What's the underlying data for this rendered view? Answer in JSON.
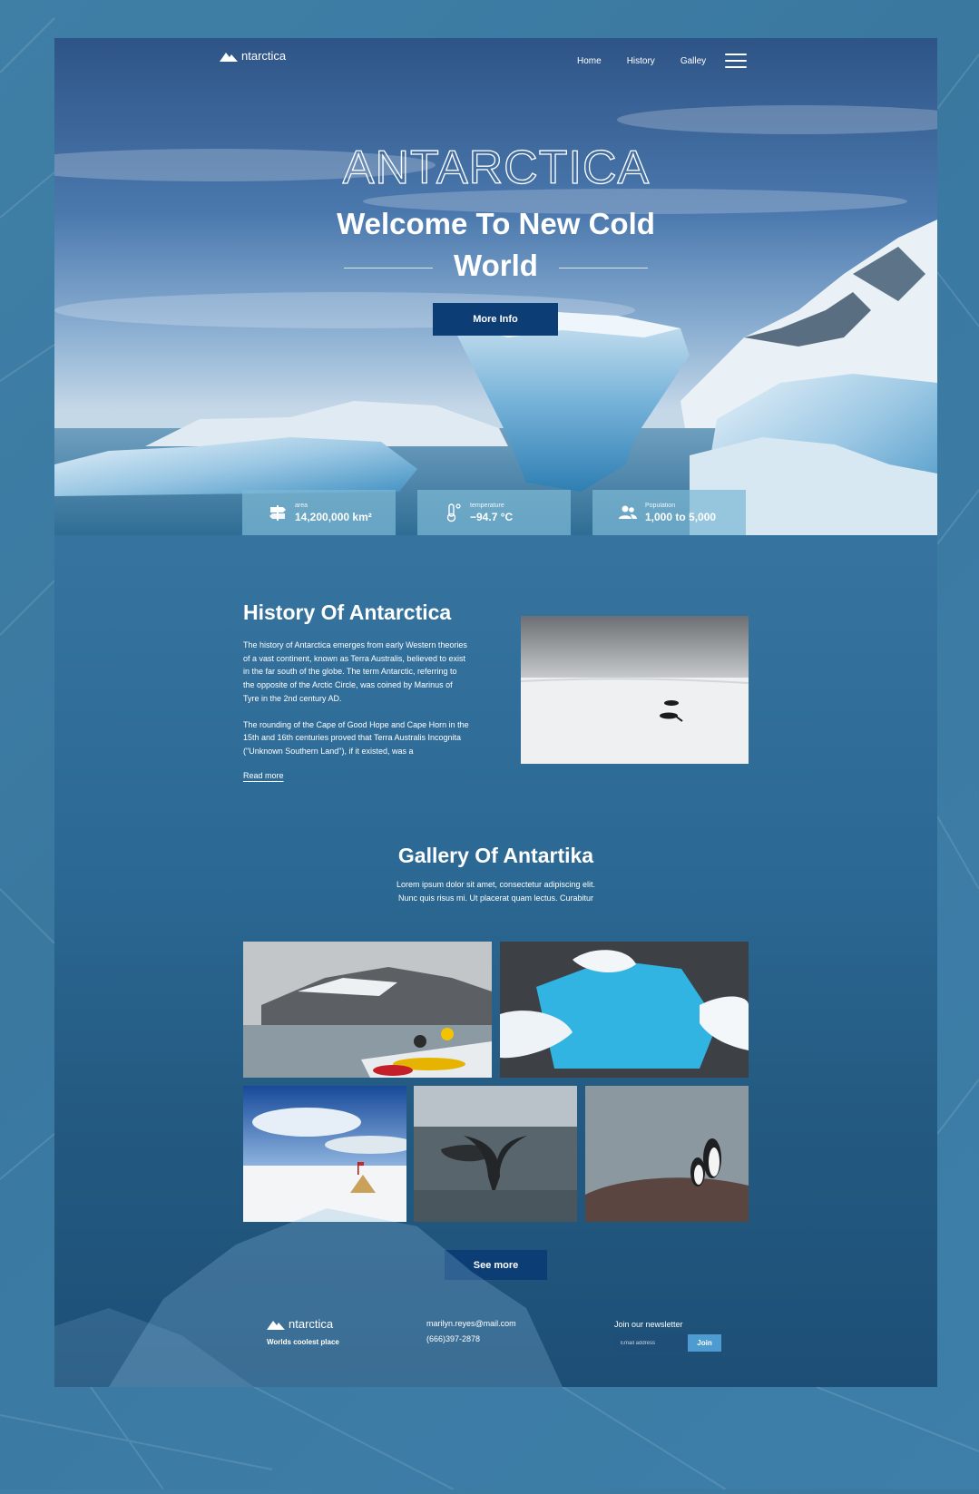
{
  "brand": {
    "logo_text": "ntarctica"
  },
  "nav": {
    "items": [
      "Home",
      "History",
      "Galley"
    ]
  },
  "hero": {
    "title": "ANTARCTICA",
    "welcome_line1": "Welcome To New Cold",
    "welcome_line2": "World",
    "cta_label": "More Info"
  },
  "stats": [
    {
      "icon": "signpost-icon",
      "label": "area",
      "value": "14,200,000 km²"
    },
    {
      "icon": "thermometer-icon",
      "label": "temperature",
      "value": "−94.7 °C"
    },
    {
      "icon": "people-icon",
      "label": "Population",
      "value": "1,000 to 5,000"
    }
  ],
  "history": {
    "title": "History Of Antarctica",
    "paragraph1": "The history of Antarctica emerges from early Western theories of a vast continent, known as Terra Australis, believed to exist in the far south of the globe. The term Antarctic, referring to the opposite of the Arctic Circle, was coined by Marinus of Tyre in the 2nd century AD.",
    "paragraph2": "The rounding of the Cape of Good Hope and Cape Horn in the 15th and 16th centuries proved that Terra Australis Incognita (\"Unknown Southern Land\"), if it existed, was a",
    "read_more": "Read more"
  },
  "gallery": {
    "title": "Gallery Of Antartika",
    "subtitle_line1": "Lorem ipsum dolor sit amet, consectetur adipiscing elit.",
    "subtitle_line2": "Nunc quis risus mi. Ut placerat quam lectus. Curabitur",
    "see_more": "See more"
  },
  "footer": {
    "logo_text": "ntarctica",
    "tagline": "Worlds coolest place",
    "email": "marilyn.reyes@mail.com",
    "phone": "(666)397-2878",
    "newsletter_label": "Join our newsletter",
    "email_placeholder": "Email address",
    "join_label": "Join"
  },
  "colors": {
    "page_bg": "#3b77a3",
    "button_primary": "#0c3d75",
    "join_button": "#4d9bd0",
    "stat_card": "#7db9d4"
  }
}
